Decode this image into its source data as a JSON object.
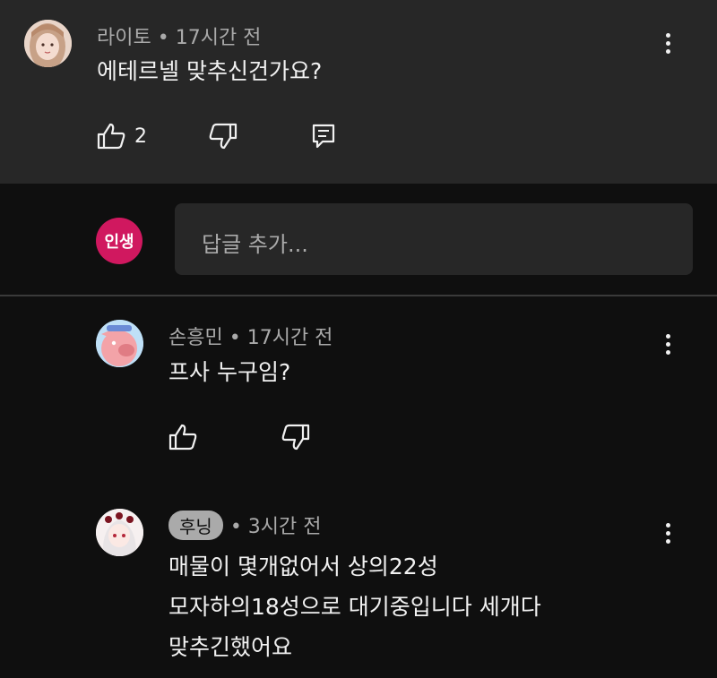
{
  "colors": {
    "background": "#0f0f0f",
    "highlight_background": "#272727",
    "primary_text": "#f1f1f1",
    "secondary_text": "#aaaaaa",
    "reply_avatar": "#d0185f",
    "author_chip": "#aaaaaa"
  },
  "comments": [
    {
      "author": "라이토",
      "time": "17시간 전",
      "text": "에테르넬 맞추신건가요?",
      "likes": "2",
      "avatar_icon": "user-avatar-photo"
    },
    {
      "author": "손흥민",
      "time": "17시간 전",
      "text": "프사 누구임?",
      "avatar_icon": "user-avatar-cartoon"
    },
    {
      "author": "후닝",
      "time": "3시간 전",
      "lines": [
        "매물이 몇개없어서 상의22성",
        "모자하의18성으로 대기중입니다 세개다",
        "맞추긴했어요"
      ],
      "avatar_icon": "user-avatar-anime"
    }
  ],
  "reply_box": {
    "avatar_label": "인생",
    "placeholder": "답글 추가..."
  },
  "icons": {
    "like": "thumbs-up-icon",
    "dislike": "thumbs-down-icon",
    "reply": "reply-comment-icon",
    "menu": "more-vertical-icon"
  }
}
